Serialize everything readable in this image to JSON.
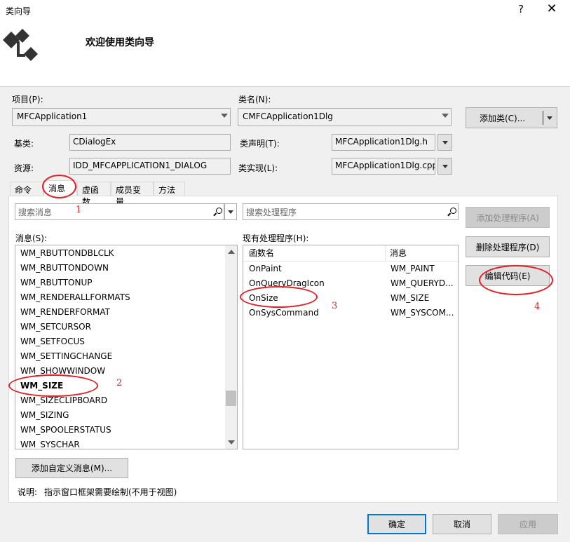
{
  "window": {
    "title": "类向导",
    "help": "?",
    "close": "✕"
  },
  "header": {
    "heading": "欢迎使用类向导",
    "logo_icon": "class-wizard-icon"
  },
  "project": {
    "label": "项目(P):",
    "value": "MFCApplication1"
  },
  "classname": {
    "label": "类名(N):",
    "value": "CMFCApplication1Dlg"
  },
  "add_class": {
    "label": "添加类(C)..."
  },
  "base": {
    "label": "基类:",
    "value": "CDialogEx"
  },
  "resource": {
    "label": "资源:",
    "value": "IDD_MFCAPPLICATION1_DIALOG"
  },
  "class_decl": {
    "label": "类声明(T):",
    "value": "MFCApplication1Dlg.h"
  },
  "class_impl": {
    "label": "类实现(L):",
    "value": "MFCApplication1Dlg.cpp"
  },
  "tabs": [
    {
      "label": "命令"
    },
    {
      "label": "消息"
    },
    {
      "label": "虚函数"
    },
    {
      "label": "成员变量"
    },
    {
      "label": "方法"
    }
  ],
  "search_messages": {
    "placeholder": "搜索消息"
  },
  "search_handlers": {
    "placeholder": "搜索处理程序"
  },
  "messages": {
    "label": "消息(S):",
    "items": [
      "WM_RBUTTONDBLCLK",
      "WM_RBUTTONDOWN",
      "WM_RBUTTONUP",
      "WM_RENDERALLFORMATS",
      "WM_RENDERFORMAT",
      "WM_SETCURSOR",
      "WM_SETFOCUS",
      "WM_SETTINGCHANGE",
      "WM_SHOWWINDOW",
      "WM_SIZE",
      "WM_SIZECLIPBOARD",
      "WM_SIZING",
      "WM_SPOOLERSTATUS",
      "WM_SYSCHAR"
    ]
  },
  "handlers": {
    "label": "现有处理程序(H):",
    "columns": [
      "函数名",
      "消息"
    ],
    "rows": [
      [
        "OnPaint",
        "WM_PAINT"
      ],
      [
        "OnQueryDragIcon",
        "WM_QUERYD..."
      ],
      [
        "OnSize",
        "WM_SIZE"
      ],
      [
        "OnSysCommand",
        "WM_SYSCOM..."
      ]
    ]
  },
  "buttons": {
    "add_handler": "添加处理程序(A)",
    "delete_handler": "删除处理程序(D)",
    "edit_code": "编辑代码(E)",
    "add_custom_message": "添加自定义消息(M)...",
    "ok": "确定",
    "cancel": "取消",
    "apply": "应用"
  },
  "description": {
    "label": "说明:",
    "text": "指示窗口框架需要绘制(不用于视图)"
  },
  "annotations": [
    "1",
    "2",
    "3",
    "4"
  ],
  "colors": {
    "annotation": "#e31e24",
    "accent": "#0078d7"
  }
}
